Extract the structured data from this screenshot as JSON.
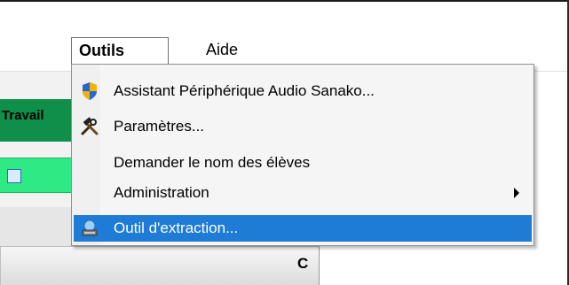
{
  "menubar": {
    "menus": [
      {
        "label": "Outils",
        "active": true
      },
      {
        "label": "Aide",
        "active": false
      }
    ]
  },
  "dropdown": {
    "items": [
      {
        "label": "Assistant Périphérique Audio Sanako...",
        "icon": "shield-icon"
      },
      {
        "label": "Paramètres...",
        "icon": "tools-icon"
      },
      {
        "label": "Demander le nom des élèves",
        "icon": ""
      },
      {
        "label": "Administration",
        "icon": "",
        "submenu": true
      },
      {
        "label": "Outil d'extraction...",
        "icon": "extract-icon",
        "highlighted": true
      }
    ]
  },
  "background": {
    "panel_title": "Travail",
    "column_header": "C"
  },
  "colors": {
    "highlight": "#1e7bd6",
    "green_dark": "#0f8f4a",
    "green_light": "#2eea84"
  }
}
